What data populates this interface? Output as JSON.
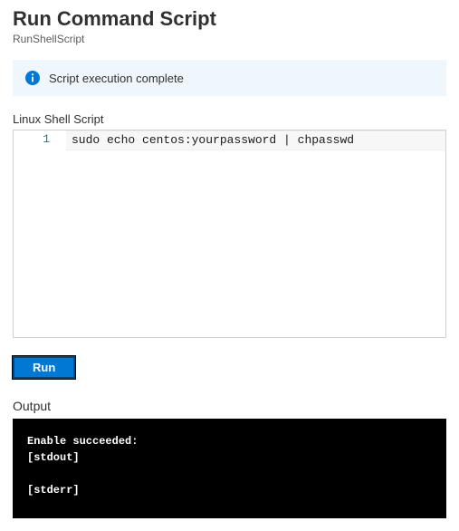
{
  "header": {
    "title": "Run Command Script",
    "subtitle": "RunShellScript"
  },
  "alert": {
    "message": "Script execution complete"
  },
  "editor": {
    "label": "Linux Shell Script",
    "line_number": "1",
    "code": "sudo echo centos:yourpassword | chpasswd"
  },
  "actions": {
    "run_label": "Run"
  },
  "output": {
    "label": "Output",
    "text": "Enable succeeded:\n[stdout]\n\n[stderr]"
  }
}
